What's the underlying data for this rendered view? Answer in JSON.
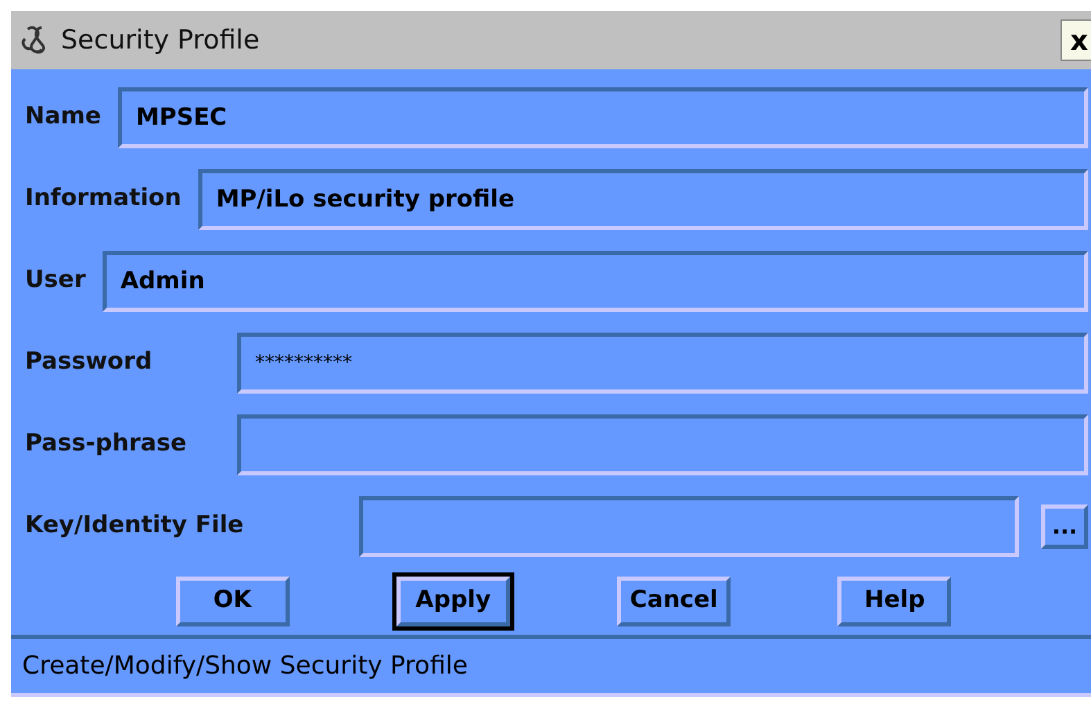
{
  "window": {
    "title": "Security Profile",
    "close": "x"
  },
  "fields": [
    {
      "label": "Name",
      "value": "MPSEC"
    },
    {
      "label": "Information",
      "value": "MP/iLo security profile"
    },
    {
      "label": "User",
      "value": "Admin"
    },
    {
      "label": "Password",
      "value": "**********"
    },
    {
      "label": "Pass-phrase"
    },
    {
      "label": "Key/Identity File",
      "browse": "..."
    }
  ],
  "buttons": [
    {
      "label": "OK",
      "default": false
    },
    {
      "label": "Apply",
      "default": true
    },
    {
      "label": "Cancel",
      "default": false
    },
    {
      "label": "Help",
      "default": false
    }
  ],
  "status_bar": "Create/Modify/Show Security Profile"
}
